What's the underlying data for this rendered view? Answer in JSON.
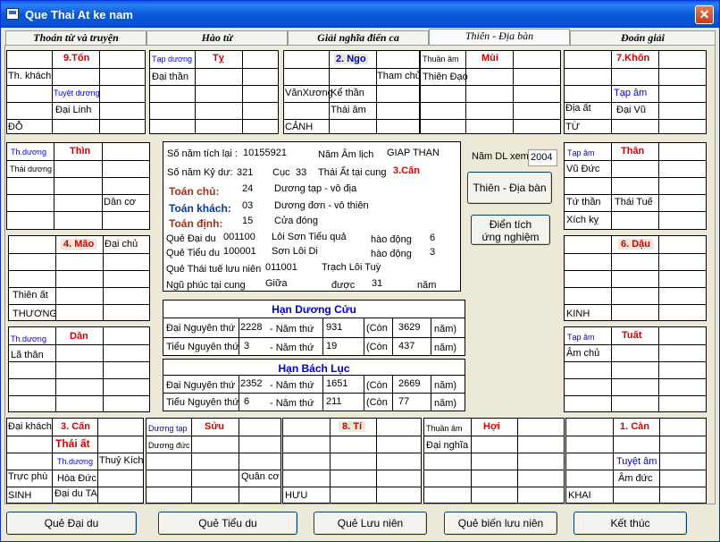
{
  "window": {
    "title": "Que Thai At ke nam",
    "close_glyph": "✕"
  },
  "tabs": [
    "Thoán từ và truyện",
    "Hào từ",
    "Giải nghĩa điển ca",
    "Thiên - Địa bàn",
    "Đoán giải"
  ],
  "palaces": {
    "p9": {
      "name": "9.Tốn",
      "l1": "Th. khách",
      "l2": "Tuyệt dương",
      "l3": "Đại Linh",
      "l4": "ĐỖ"
    },
    "ty": {
      "name": "Tỵ",
      "l1": "Tạp dương",
      "l2": "Đại thần"
    },
    "p2": {
      "name": "2. Ngo",
      "l1": "Tham chủ",
      "l2": "VănXương",
      "l3": "Kể thần",
      "l4": "Thái âm",
      "l5": "CẢNH"
    },
    "mui": {
      "name": "Mùi",
      "l1": "Thuần âm",
      "l2": "Thiên Đạo"
    },
    "p7": {
      "name": "7.Khôn",
      "l1": "Tạp âm",
      "l2": "Địa ất",
      "l3": "Đại Vũ",
      "l4": "TỪ"
    },
    "thin": {
      "name": "Thìn",
      "l1": "Th.dương",
      "l2": "Thái dương",
      "l3": "Dân cơ"
    },
    "than": {
      "name": "Thân",
      "l1": "Tạp âm",
      "l2": "Vũ Đức",
      "l3": "Tứ thần",
      "l4": "Thái Tuế",
      "l5": "Xích kỵ"
    },
    "p4": {
      "name": "4. Mão",
      "l1": "Đại chủ",
      "l2": "Thiên ất",
      "l3": "THƯƠNG"
    },
    "p6": {
      "name": "6. Dậu",
      "l1": "KINH"
    },
    "dan": {
      "name": "Dần",
      "l1": "Th.dương",
      "l2": "Lã thân"
    },
    "tuat": {
      "name": "Tuất",
      "l1": "Tạp âm",
      "l2": "Âm chủ"
    },
    "p3": {
      "name": "3. Cấn",
      "l1": "Đại khách",
      "l2": "Thái ất",
      "l3": "Th.dương",
      "l4": "Thuỷ Kích",
      "l5": "Trực phù",
      "l6": "Hòa Đức",
      "l7": "SINH",
      "l8": "Đại du TA"
    },
    "suu": {
      "name": "Sửu",
      "l1": "Dương tạp",
      "l2": "Dương đức",
      "l3": "Quân cơ"
    },
    "p8": {
      "name": "8. Tí",
      "l1": "HƯU"
    },
    "hoi": {
      "name": "Hợi",
      "l1": "Thuần âm",
      "l2": "Đại nghĩa"
    },
    "p1": {
      "name": "1. Càn",
      "l1": "Tuyệt âm",
      "l2": "Âm đức",
      "l3": "KHAI"
    }
  },
  "center": {
    "so_nam_tich_lai_label": "Số năm tích lại :",
    "so_nam_tich_lai": "10155921",
    "nam_am_lich_label": "Năm Âm lịch",
    "nam_am_lich": "GIAP THAN",
    "so_nam_ky_du_label": "Số năm Kỷ dư:",
    "so_nam_ky_du": "321",
    "cuc_label": "Cục",
    "cuc": "33",
    "thai_at_label": "Thái Ất tại cung",
    "thai_at": "3.Cấn",
    "toan_chu_label": "Toán chủ:",
    "toan_chu": "24",
    "toan_chu_desc": "Dương tạp - vô địa",
    "toan_khach_label": "Toán khách:",
    "toan_khach": "03",
    "toan_khach_desc": "Dương đơn - vô thiên",
    "toan_dinh_label": "Toán định:",
    "toan_dinh": "15",
    "toan_dinh_desc": "Cửa đóng",
    "que_dai_du_label": "Quẻ Đại du",
    "que_dai_du": "001100",
    "que_dai_du_name": "Lôi Sơn Tiểu quả",
    "hao_dong_label": "hào động",
    "hao_dong_1": "6",
    "que_tieu_du_label": "Quẻ Tiểu du",
    "que_tieu_du": "100001",
    "que_tieu_du_name": "Sơn Lôi Di",
    "hao_dong_2": "3",
    "que_thai_tue_label": "Quẻ Thái tuế lưu niên",
    "que_thai_tue": "011001",
    "que_thai_tue_name": "Trạch Lôi Tuỳ",
    "ngu_phuc_label": "Ngũ phúc tại cung",
    "ngu_phuc": "Giữa",
    "duoc_label": "được",
    "duoc": "31",
    "nam_label": "năm"
  },
  "right_ctrl": {
    "nam_dl_label": "Năm DL xem",
    "nam_dl": "2004",
    "btn_thien_dia": "Thiên - Địa bàn",
    "btn_dien_tich_1": "Điển tích",
    "btn_dien_tich_2": "ứng nghiệm"
  },
  "han_duong_cuu": {
    "title": "Hạn Dương Cửu",
    "r1": {
      "a": "Đại Nguyên thứ",
      "b": "2228",
      "c": "- Năm thứ",
      "d": "931",
      "e": "(Còn",
      "f": "3629",
      "g": "năm)"
    },
    "r2": {
      "a": "Tiểu Nguyên thứ",
      "b": "3",
      "c": "- Năm thứ",
      "d": "19",
      "e": "(Còn",
      "f": "437",
      "g": "năm)"
    }
  },
  "han_bach_luc": {
    "title": "Hạn Bách Lục",
    "r1": {
      "a": "Đại Nguyên thứ",
      "b": "2352",
      "c": "- Năm thứ",
      "d": "1651",
      "e": "(Còn",
      "f": "2669",
      "g": "năm)"
    },
    "r2": {
      "a": "Tiểu Nguyên thứ",
      "b": "6",
      "c": "- Năm thứ",
      "d": "211",
      "e": "(Còn",
      "f": "77",
      "g": "năm)"
    }
  },
  "bottom_buttons": [
    "Quẻ Đại du",
    "Quẻ Tiểu du",
    "Quẻ Lưu niên",
    "Quẻ biến lưu niên",
    "Kết thúc"
  ]
}
